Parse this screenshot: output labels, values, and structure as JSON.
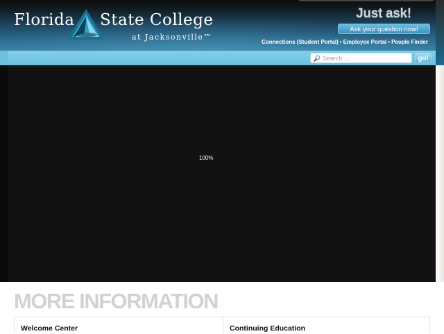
{
  "header": {
    "logo": {
      "word1": "Florida",
      "word2": "State College",
      "sub": "at Jacksonville™"
    },
    "just_ask": {
      "title": "Just ask!",
      "button": "Ask your question now!"
    },
    "links": [
      "Connections (Student Portal)",
      "Employee Portal",
      "People Finder"
    ],
    "link_separator": "•"
  },
  "search": {
    "placeholder": "Search ...",
    "value": "",
    "button": "go!"
  },
  "slideshow": {
    "loading_text": "100%"
  },
  "more_info": {
    "title": "MORE INFORMATION",
    "columns": [
      {
        "heading": "Welcome Center"
      },
      {
        "heading": "Continuing Education"
      }
    ]
  },
  "colors": {
    "brand_blue": "#3a82a8",
    "search_bar": "#7ccbe6",
    "slideshow_bg": "#121212",
    "section_title": "#d2d2d2"
  },
  "icons": {
    "search": "search-icon",
    "logo": "fscj-logo-icon"
  }
}
